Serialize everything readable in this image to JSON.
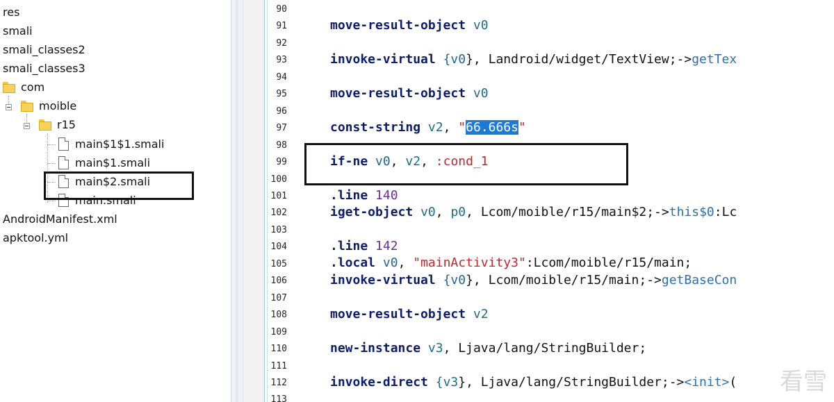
{
  "tree": {
    "items": [
      {
        "label": "res"
      },
      {
        "label": "smali"
      },
      {
        "label": "smali_classes2"
      },
      {
        "label": "smali_classes3"
      },
      {
        "label": "com"
      },
      {
        "label": "moible"
      },
      {
        "label": "r15"
      },
      {
        "label": "main$1$1.smali"
      },
      {
        "label": "main$1.smali"
      },
      {
        "label": "main$2.smali"
      },
      {
        "label": "main.smali"
      },
      {
        "label": "AndroidManifest.xml"
      },
      {
        "label": "apktool.yml"
      }
    ]
  },
  "editor": {
    "line_numbers": [
      "90",
      "91",
      "92",
      "93",
      "94",
      "95",
      "96",
      "97",
      "98",
      "99",
      "100",
      "101",
      "102",
      "103",
      "104",
      "105",
      "106",
      "107",
      "108",
      "109",
      "110",
      "111",
      "112",
      "113"
    ],
    "lines": {
      "l91": {
        "op": "move-result-object",
        "r1": "v0"
      },
      "l93": {
        "op": "invoke-virtual",
        "a": "{",
        "r1": "v0",
        "b": "}, Landroid/widget/TextView;->",
        "m": "getTex"
      },
      "l95": {
        "op": "move-result-object",
        "r1": "v0"
      },
      "l97": {
        "op": "const-string",
        "r1": "v2",
        "q1": "\"",
        "s": "66.666s",
        "q2": "\""
      },
      "l99": {
        "op": "if-ne",
        "r1": "v0",
        "r2": "v2",
        "lbl": ":cond_1"
      },
      "l101": {
        "op": ".line",
        "n": "140"
      },
      "l102": {
        "op": "iget-object",
        "r1": "v0",
        "r2": "p0",
        "b": "Lcom/moible/r15/main$2;->",
        "m": "this$0",
        "c": ":Lc"
      },
      "l104": {
        "op": ".line",
        "n": "142"
      },
      "l105": {
        "op": ".local",
        "r1": "v0",
        "s": "\"mainActivity3\"",
        "b": ":Lcom/moible/r15/main;"
      },
      "l106": {
        "op": "invoke-virtual",
        "a": "{",
        "r1": "v0",
        "b": "}, Lcom/moible/r15/main;->",
        "m": "getBaseCon"
      },
      "l108": {
        "op": "move-result-object",
        "r1": "v2"
      },
      "l110": {
        "op": "new-instance",
        "r1": "v3",
        "b": "Ljava/lang/StringBuilder;"
      },
      "l112": {
        "op": "invoke-direct",
        "a": "{",
        "r1": "v3",
        "b": "}, Ljava/lang/StringBuilder;->",
        "m": "<init>",
        "c": "("
      }
    }
  },
  "watermark": "看雪",
  "colors": {
    "keyword": "#0b1c6d",
    "register": "#1e6a8c",
    "string": "#c7252a",
    "number": "#6c2ba0",
    "selection": "#1c7bd8"
  }
}
